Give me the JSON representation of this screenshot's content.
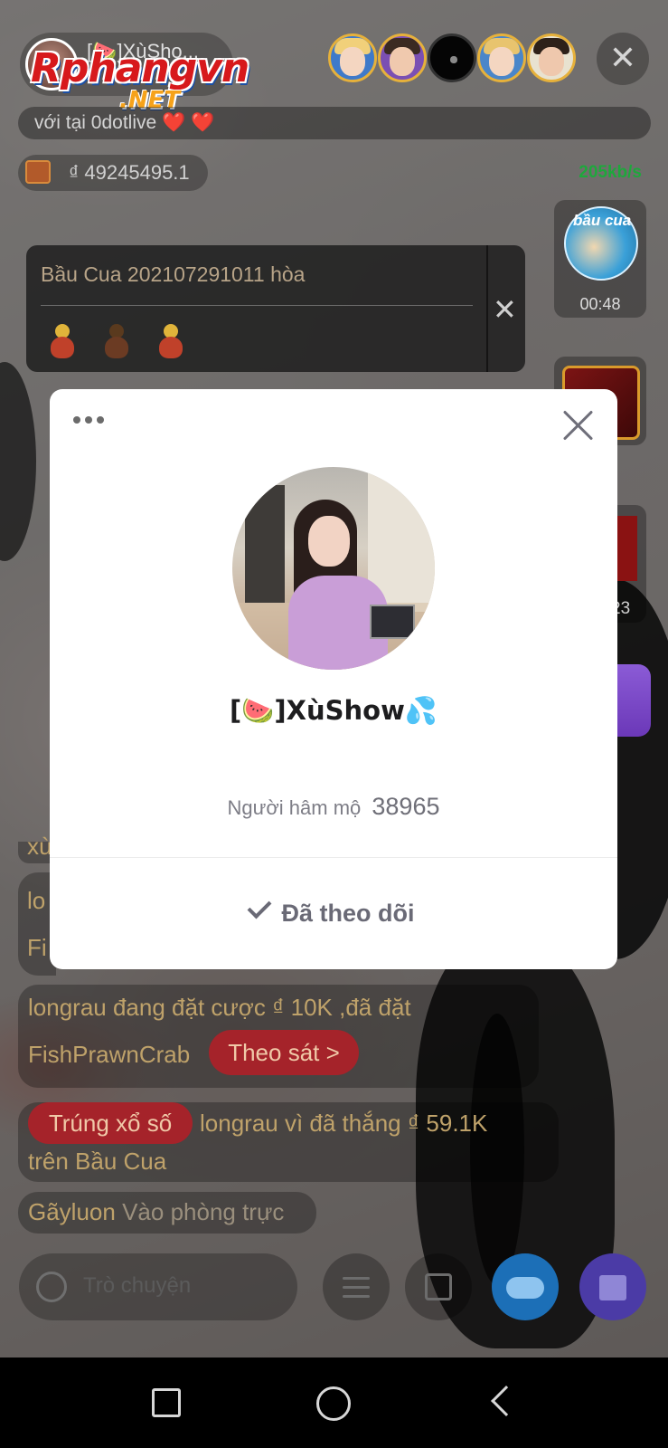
{
  "header": {
    "host_name": "[🍉]XùSho...",
    "watermark_main": "Rphangvn",
    "watermark_sub": ".NET",
    "close_icon": "close-icon"
  },
  "marquee": {
    "text": "với tại 0dotlive",
    "hearts": "❤️ ❤️"
  },
  "wallet": {
    "currency": "₫",
    "amount": "49245495.1"
  },
  "network": {
    "speed": "205kb/s"
  },
  "side_games": {
    "bau_cua_label": "bầu cua",
    "bau_cua_timer": "00:48",
    "third_timer": "23"
  },
  "game_result": {
    "title": "Bầu Cua 202107291011 hòa",
    "close_label": "✕"
  },
  "chat": {
    "partial_top": "xù",
    "partial_lo": "lo",
    "partial_fi": "Fi",
    "bet_line1": "longrau đang đặt cược ₫ 10K ,đã đặt",
    "bet_line2": "FishPrawnCrab",
    "follow_btn": "Theo sát >",
    "win_badge": "Trúng xổ số",
    "win_line1": "longrau vì đã thắng ₫ 59.1K",
    "win_line2": "trên Bầu Cua",
    "join_user": "Gãyluon",
    "join_text": "Vào phòng trực"
  },
  "bottom_bar": {
    "chat_placeholder": "Trò chuyện"
  },
  "profile_modal": {
    "name": "[🍉]XùShow💦",
    "fans_label": "Người hâm mộ",
    "fans_count": "38965",
    "follow_status": "Đã theo dõi"
  },
  "colors": {
    "accent_gold": "#bfa26a",
    "speed_green": "#1ea83c",
    "badge_red": "#a5232a",
    "modal_bg": "#ffffff"
  }
}
